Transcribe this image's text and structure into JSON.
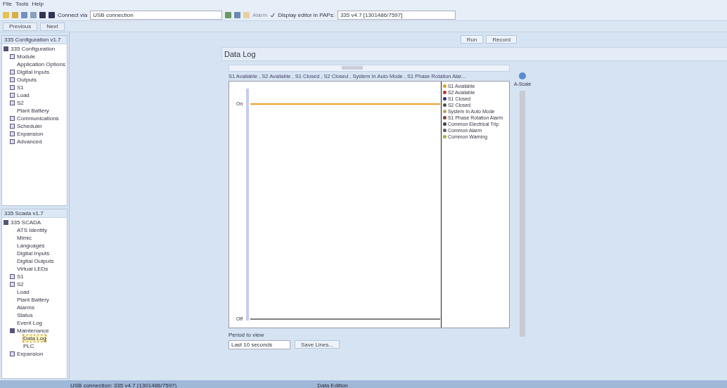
{
  "menu": [
    "File",
    "Tools",
    "Help"
  ],
  "toolbar": {
    "connect_label": "Connect via",
    "connection": "USB connection",
    "alarm": "Alarm",
    "display_editor": {
      "label": "Display editor in PAPs:",
      "checked": true
    },
    "device": "335 v4.7 [1301486/7597]"
  },
  "nav": {
    "previous": "Previous",
    "next": "Next"
  },
  "action_buttons": [
    "Run",
    "Record"
  ],
  "config_panel": {
    "title": "335 Configuration v1.7",
    "tree": [
      {
        "label": "335 Configuration",
        "expanded": true,
        "selected": false,
        "children": [
          {
            "label": "Module",
            "expanded": false,
            "selected": false
          },
          {
            "label": "Application Options",
            "selected": false
          },
          {
            "label": "Digital Inputs",
            "expanded": false,
            "selected": false
          },
          {
            "label": "Outputs",
            "expanded": false,
            "selected": false
          },
          {
            "label": "S1",
            "expanded": false,
            "selected": false
          },
          {
            "label": "Load",
            "expanded": false,
            "selected": false
          },
          {
            "label": "S2",
            "expanded": false,
            "selected": false
          },
          {
            "label": "Plant Battery",
            "selected": false
          },
          {
            "label": "Communications",
            "expanded": false,
            "selected": false
          },
          {
            "label": "Scheduler",
            "expanded": false,
            "selected": false
          },
          {
            "label": "Expansion",
            "expanded": false,
            "selected": false
          },
          {
            "label": "Advanced",
            "expanded": false,
            "selected": false
          }
        ]
      }
    ]
  },
  "scada_panel": {
    "title": "335 Scada v1.7",
    "tree": [
      {
        "label": "335 SCADA",
        "expanded": true,
        "selected": false,
        "children": [
          {
            "label": "ATS Identity",
            "selected": false
          },
          {
            "label": "Mimic",
            "selected": false
          },
          {
            "label": "Languages",
            "selected": false
          },
          {
            "label": "Digital Inputs",
            "selected": false
          },
          {
            "label": "Digital Outputs",
            "selected": false
          },
          {
            "label": "Virtual LEDs",
            "selected": false
          },
          {
            "label": "S1",
            "expanded": false,
            "selected": false
          },
          {
            "label": "S2",
            "expanded": false,
            "selected": false
          },
          {
            "label": "Load",
            "selected": false
          },
          {
            "label": "Plant Battery",
            "selected": false
          },
          {
            "label": "Alarms",
            "selected": false
          },
          {
            "label": "Status",
            "selected": false
          },
          {
            "label": "Event Log",
            "selected": false
          },
          {
            "label": "Maintenance",
            "expanded": true,
            "selected": false,
            "children": [
              {
                "label": "Data Log",
                "selected": true
              },
              {
                "label": "PLC",
                "selected": false
              }
            ]
          },
          {
            "label": "Expansion",
            "expanded": false,
            "selected": false
          }
        ]
      }
    ]
  },
  "page_title": "Data Log",
  "chart": {
    "title": "S1 Available , S2 Available , S1 Closed , S2 Closed , System In Auto Mode , S1 Phase Rotation Alar...",
    "y_top": "On",
    "y_bottom": "Off",
    "autoscale": "A-Scale",
    "legend": [
      {
        "label": "S1 Available",
        "color": "#e0a020"
      },
      {
        "label": "S2 Available",
        "color": "#c03030"
      },
      {
        "label": "S1 Closed",
        "color": "#303090"
      },
      {
        "label": "S2 Closed",
        "color": "#505050"
      },
      {
        "label": "System In Auto Mode",
        "color": "#c0a060"
      },
      {
        "label": "S1 Phase Rotation Alarm",
        "color": "#804040"
      },
      {
        "label": "Common Electrical Trip",
        "color": "#404040"
      },
      {
        "label": "Common Alarm",
        "color": "#606060"
      },
      {
        "label": "Common Warning",
        "color": "#a0b030"
      }
    ]
  },
  "period": {
    "label": "Period to view",
    "value": "Last 10 seconds",
    "button": "Save Lines..."
  },
  "status_bar": {
    "left": "USB connection: 335 v4.7 (1301486/7597)",
    "middle": "Data Edition"
  }
}
